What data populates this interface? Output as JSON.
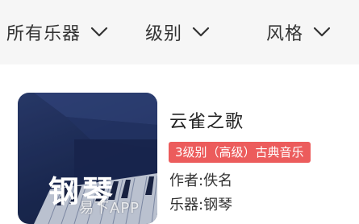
{
  "filters": [
    {
      "label": "所有乐器",
      "icon": "chevron-down-icon"
    },
    {
      "label": "级别",
      "icon": "chevron-down-icon"
    },
    {
      "label": "风格",
      "icon": "chevron-down-icon"
    }
  ],
  "song": {
    "cover_text": "钢琴",
    "title": "云雀之歌",
    "tag": "3级别（高级）古典音乐",
    "author": "作者:佚名",
    "instrument": "乐器:钢琴"
  },
  "watermark": "易下APP",
  "colors": {
    "filter_bar_bg": "#f6f6f6",
    "tag_bg": "#ec5c5c",
    "cover_bg": "#1d2b55"
  }
}
